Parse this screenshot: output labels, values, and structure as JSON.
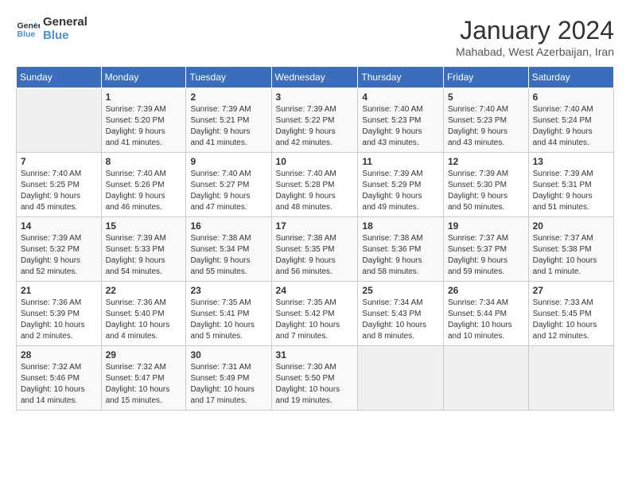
{
  "logo": {
    "line1": "General",
    "line2": "Blue"
  },
  "title": "January 2024",
  "location": "Mahabad, West Azerbaijan, Iran",
  "days_header": [
    "Sunday",
    "Monday",
    "Tuesday",
    "Wednesday",
    "Thursday",
    "Friday",
    "Saturday"
  ],
  "weeks": [
    [
      {
        "num": "",
        "info": ""
      },
      {
        "num": "1",
        "info": "Sunrise: 7:39 AM\nSunset: 5:20 PM\nDaylight: 9 hours\nand 41 minutes."
      },
      {
        "num": "2",
        "info": "Sunrise: 7:39 AM\nSunset: 5:21 PM\nDaylight: 9 hours\nand 41 minutes."
      },
      {
        "num": "3",
        "info": "Sunrise: 7:39 AM\nSunset: 5:22 PM\nDaylight: 9 hours\nand 42 minutes."
      },
      {
        "num": "4",
        "info": "Sunrise: 7:40 AM\nSunset: 5:23 PM\nDaylight: 9 hours\nand 43 minutes."
      },
      {
        "num": "5",
        "info": "Sunrise: 7:40 AM\nSunset: 5:23 PM\nDaylight: 9 hours\nand 43 minutes."
      },
      {
        "num": "6",
        "info": "Sunrise: 7:40 AM\nSunset: 5:24 PM\nDaylight: 9 hours\nand 44 minutes."
      }
    ],
    [
      {
        "num": "7",
        "info": "Sunrise: 7:40 AM\nSunset: 5:25 PM\nDaylight: 9 hours\nand 45 minutes."
      },
      {
        "num": "8",
        "info": "Sunrise: 7:40 AM\nSunset: 5:26 PM\nDaylight: 9 hours\nand 46 minutes."
      },
      {
        "num": "9",
        "info": "Sunrise: 7:40 AM\nSunset: 5:27 PM\nDaylight: 9 hours\nand 47 minutes."
      },
      {
        "num": "10",
        "info": "Sunrise: 7:40 AM\nSunset: 5:28 PM\nDaylight: 9 hours\nand 48 minutes."
      },
      {
        "num": "11",
        "info": "Sunrise: 7:39 AM\nSunset: 5:29 PM\nDaylight: 9 hours\nand 49 minutes."
      },
      {
        "num": "12",
        "info": "Sunrise: 7:39 AM\nSunset: 5:30 PM\nDaylight: 9 hours\nand 50 minutes."
      },
      {
        "num": "13",
        "info": "Sunrise: 7:39 AM\nSunset: 5:31 PM\nDaylight: 9 hours\nand 51 minutes."
      }
    ],
    [
      {
        "num": "14",
        "info": "Sunrise: 7:39 AM\nSunset: 5:32 PM\nDaylight: 9 hours\nand 52 minutes."
      },
      {
        "num": "15",
        "info": "Sunrise: 7:39 AM\nSunset: 5:33 PM\nDaylight: 9 hours\nand 54 minutes."
      },
      {
        "num": "16",
        "info": "Sunrise: 7:38 AM\nSunset: 5:34 PM\nDaylight: 9 hours\nand 55 minutes."
      },
      {
        "num": "17",
        "info": "Sunrise: 7:38 AM\nSunset: 5:35 PM\nDaylight: 9 hours\nand 56 minutes."
      },
      {
        "num": "18",
        "info": "Sunrise: 7:38 AM\nSunset: 5:36 PM\nDaylight: 9 hours\nand 58 minutes."
      },
      {
        "num": "19",
        "info": "Sunrise: 7:37 AM\nSunset: 5:37 PM\nDaylight: 9 hours\nand 59 minutes."
      },
      {
        "num": "20",
        "info": "Sunrise: 7:37 AM\nSunset: 5:38 PM\nDaylight: 10 hours\nand 1 minute."
      }
    ],
    [
      {
        "num": "21",
        "info": "Sunrise: 7:36 AM\nSunset: 5:39 PM\nDaylight: 10 hours\nand 2 minutes."
      },
      {
        "num": "22",
        "info": "Sunrise: 7:36 AM\nSunset: 5:40 PM\nDaylight: 10 hours\nand 4 minutes."
      },
      {
        "num": "23",
        "info": "Sunrise: 7:35 AM\nSunset: 5:41 PM\nDaylight: 10 hours\nand 5 minutes."
      },
      {
        "num": "24",
        "info": "Sunrise: 7:35 AM\nSunset: 5:42 PM\nDaylight: 10 hours\nand 7 minutes."
      },
      {
        "num": "25",
        "info": "Sunrise: 7:34 AM\nSunset: 5:43 PM\nDaylight: 10 hours\nand 8 minutes."
      },
      {
        "num": "26",
        "info": "Sunrise: 7:34 AM\nSunset: 5:44 PM\nDaylight: 10 hours\nand 10 minutes."
      },
      {
        "num": "27",
        "info": "Sunrise: 7:33 AM\nSunset: 5:45 PM\nDaylight: 10 hours\nand 12 minutes."
      }
    ],
    [
      {
        "num": "28",
        "info": "Sunrise: 7:32 AM\nSunset: 5:46 PM\nDaylight: 10 hours\nand 14 minutes."
      },
      {
        "num": "29",
        "info": "Sunrise: 7:32 AM\nSunset: 5:47 PM\nDaylight: 10 hours\nand 15 minutes."
      },
      {
        "num": "30",
        "info": "Sunrise: 7:31 AM\nSunset: 5:49 PM\nDaylight: 10 hours\nand 17 minutes."
      },
      {
        "num": "31",
        "info": "Sunrise: 7:30 AM\nSunset: 5:50 PM\nDaylight: 10 hours\nand 19 minutes."
      },
      {
        "num": "",
        "info": ""
      },
      {
        "num": "",
        "info": ""
      },
      {
        "num": "",
        "info": ""
      }
    ]
  ]
}
